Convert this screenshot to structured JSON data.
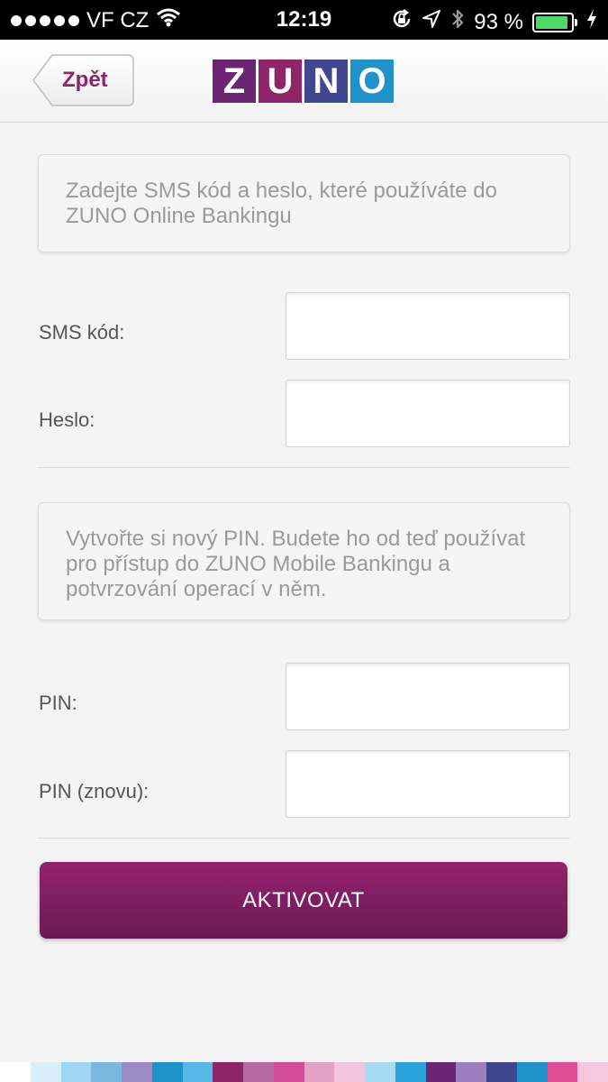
{
  "status_bar": {
    "carrier": "VF CZ",
    "time": "12:19",
    "battery_percent": "93 %",
    "battery_level": 0.93,
    "icons": [
      "signal-dots-icon",
      "wifi-icon",
      "rotation-lock-icon",
      "location-icon",
      "bluetooth-icon",
      "battery-icon",
      "charging-icon"
    ]
  },
  "nav": {
    "back_label": "Zpět",
    "logo_letters": [
      "Z",
      "U",
      "N",
      "O"
    ],
    "logo_colors": [
      "#6b2572",
      "#8e2569",
      "#40478f",
      "#1f92c9"
    ]
  },
  "intro": {
    "text": "Zadejte SMS kód a heslo, které používáte do ZUNO Online Bankingu"
  },
  "fields": {
    "sms_label": "SMS kód:",
    "sms_value": "",
    "password_label": "Heslo:",
    "password_value": "",
    "pin_label": "PIN:",
    "pin_value": "",
    "pin_repeat_label": "PIN (znovu):",
    "pin_repeat_value": ""
  },
  "pin_info": {
    "text": "Vytvořte si nový PIN. Budete ho od teď používat pro přístup do ZUNO Mobile Bankingu a potvrzování operací v něm."
  },
  "actions": {
    "activate_label": "AKTIVOVAT"
  },
  "colors": {
    "brand_purple": "#8e2569",
    "button_top": "#93226e",
    "button_bottom": "#6a1a55",
    "battery_green": "#4cd964"
  }
}
